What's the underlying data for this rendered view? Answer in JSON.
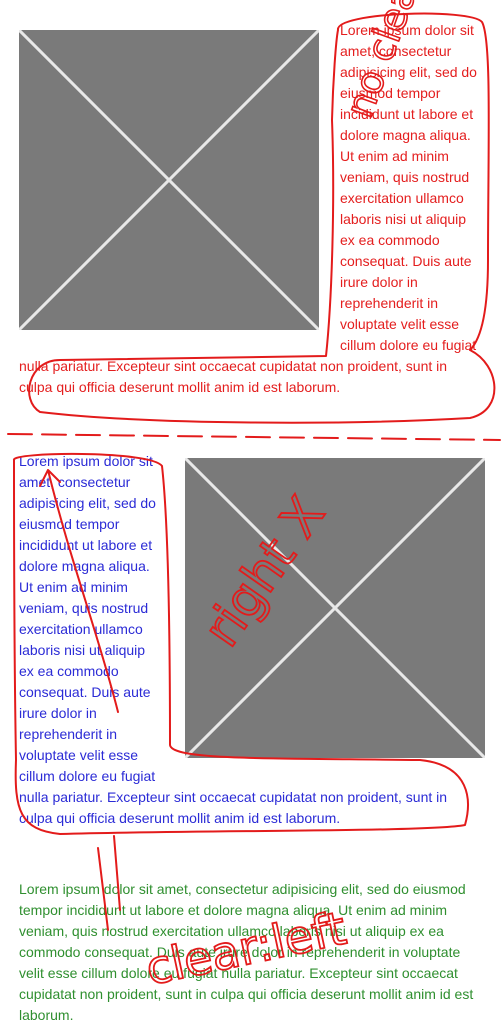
{
  "sections": [
    {
      "id": "clear-none",
      "text": "Lorem ipsum dolor sit amet, consectetur adipisicing elit, sed do eiusmod tempor incididunt ut labore et dolore magna aliqua. Ut enim ad minim veniam, quis nostrud exercitation ullamco laboris nisi ut aliquip ex ea commodo consequat. Duis aute irure dolor in reprehenderit in voluptate velit esse cillum dolore eu fugiat nulla pariatur. Excepteur sint occaecat cupidatat non proident, sunt in culpa qui officia deserunt mollit anim id est laborum.",
      "color": "#e41e1e",
      "image_icon": "image-placeholder-icon"
    },
    {
      "id": "right-float",
      "text": "Lorem ipsum dolor sit amet, consectetur adipisicing elit, sed do eiusmod tempor incididunt ut labore et dolore magna aliqua. Ut enim ad minim veniam, quis nostrud exercitation ullamco laboris nisi ut aliquip ex ea commodo consequat. Duis aute irure dolor in reprehenderit in voluptate velit esse cillum dolore eu fugiat nulla pariatur. Excepteur sint occaecat cupidatat non proident, sunt in culpa qui officia deserunt mollit anim id est laborum.",
      "color": "#2b2bd6",
      "image_icon": "image-placeholder-icon"
    },
    {
      "id": "clear-left",
      "text": "Lorem ipsum dolor sit amet, consectetur adipisicing elit, sed do eiusmod tempor incididunt ut labore et dolore magna aliqua. Ut enim ad minim veniam, quis nostrud exercitation ullamco laboris nisi ut aliquip ex ea commodo consequat. Duis aute irure dolor in reprehenderit in voluptate velit esse cillum dolore eu fugiat nulla pariatur. Excepteur sint occaecat cupidatat non proident, sunt in culpa qui officia deserunt mollit anim id est laborum.",
      "color": "#2f8f2f"
    }
  ],
  "annotations": {
    "color": "#e31b1b",
    "top_note": "no clear left",
    "middle_note": "right X",
    "bottom_note": "clear:left"
  }
}
